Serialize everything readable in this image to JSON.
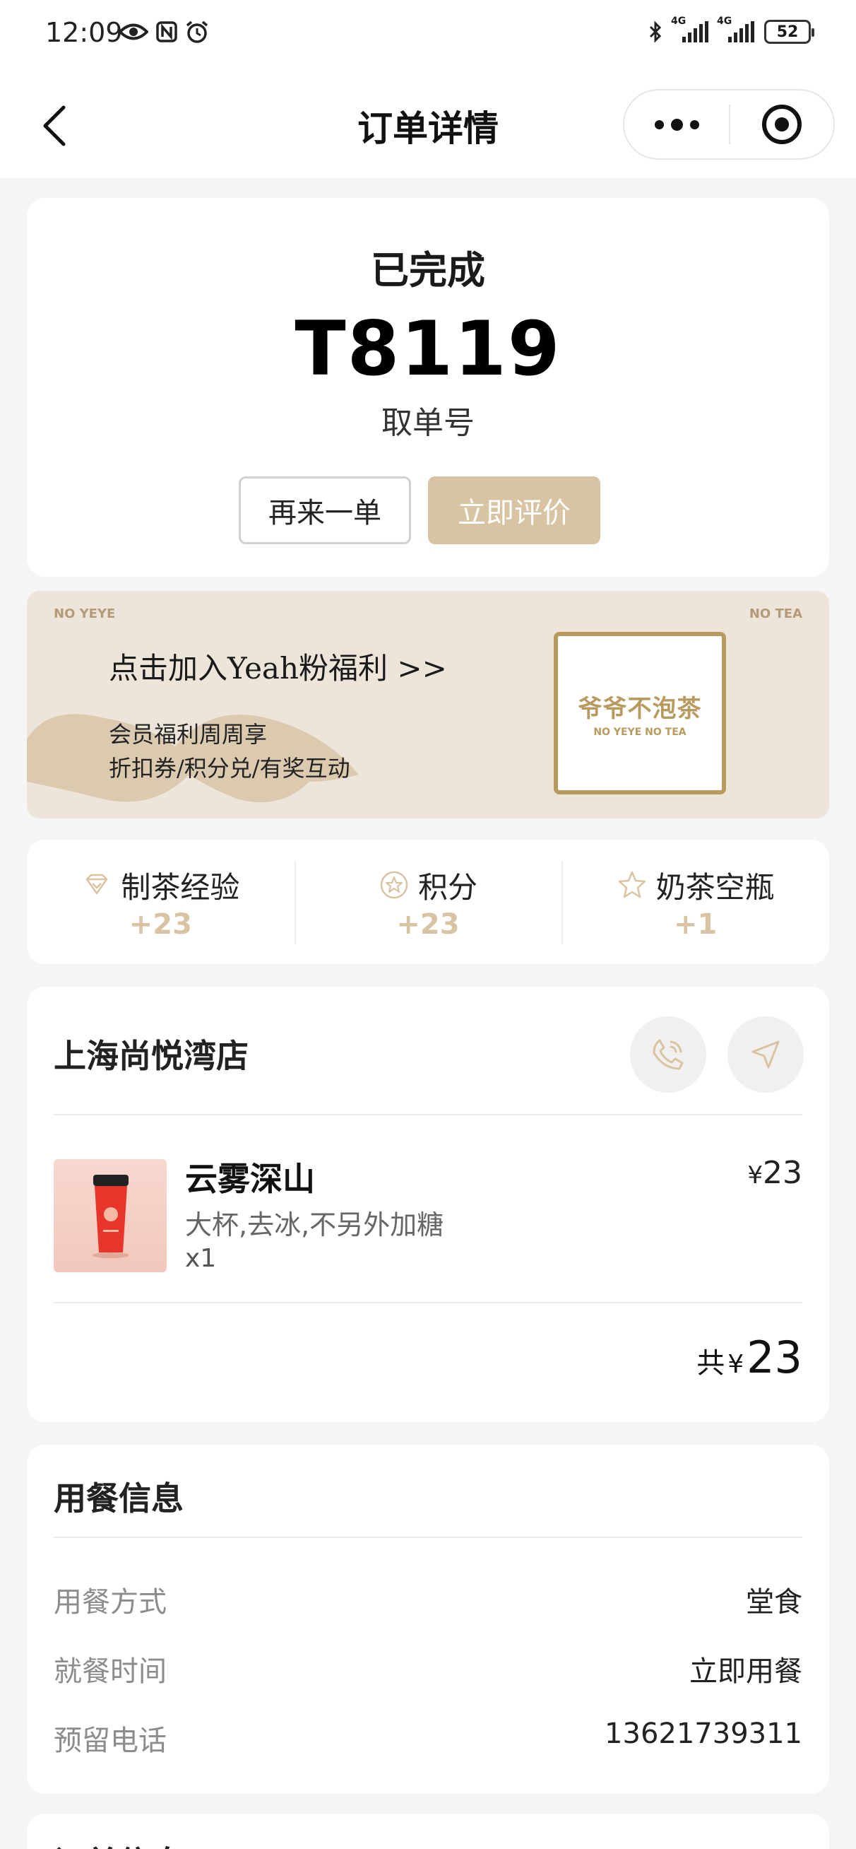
{
  "status_bar": {
    "time": "12:09",
    "network1": "4G",
    "network2": "4G",
    "battery": "52",
    "left_icons": [
      "eye-icon",
      "nfc-icon",
      "alarm-icon"
    ],
    "right_icons": [
      "bluetooth-icon",
      "signal-icon",
      "signal-icon",
      "battery-icon"
    ]
  },
  "nav": {
    "title": "订单详情",
    "icons": [
      "back-icon",
      "more-icon",
      "target-icon"
    ]
  },
  "order": {
    "status": "已完成",
    "pickup_number": "T8119",
    "pickup_label": "取单号",
    "reorder_label": "再来一单",
    "review_label": "立即评价"
  },
  "banner": {
    "tag_left": "NO YEYE",
    "tag_right": "NO TEA",
    "headline": "点击加入Yeah粉福利 >>",
    "sub1": "会员福利周周享",
    "sub2": "折扣券/积分兑/有奖互动",
    "logo_cn": "爷爷不泡茶",
    "logo_en": "NO YEYE NO TEA"
  },
  "rewards": [
    {
      "label": "制茶经验",
      "value": "+23",
      "icon": "diamond-icon"
    },
    {
      "label": "积分",
      "value": "+23",
      "icon": "star-badge-icon"
    },
    {
      "label": "奶茶空瓶",
      "value": "+1",
      "icon": "star-icon"
    }
  ],
  "store": {
    "name": "上海尚悦湾店",
    "icons": [
      "phone-icon",
      "navigation-icon"
    ]
  },
  "product": {
    "name": "云雾深山",
    "spec": "大杯,去冰,不另外加糖",
    "qty": "x1",
    "currency": "¥",
    "price": "23"
  },
  "total": {
    "label": "共",
    "currency": "¥",
    "amount": "23"
  },
  "dining": {
    "title": "用餐信息",
    "rows": [
      {
        "key": "用餐方式",
        "value": "堂食"
      },
      {
        "key": "就餐时间",
        "value": "立即用餐"
      },
      {
        "key": "预留电话",
        "value": "13621739311"
      }
    ]
  },
  "next_section": {
    "title": "订单信息"
  },
  "colors": {
    "accent": "#d8c4a3",
    "banner_bg": "#eee5da",
    "logo_gold": "#b89a5e",
    "page_bg": "#f5f5f5"
  }
}
